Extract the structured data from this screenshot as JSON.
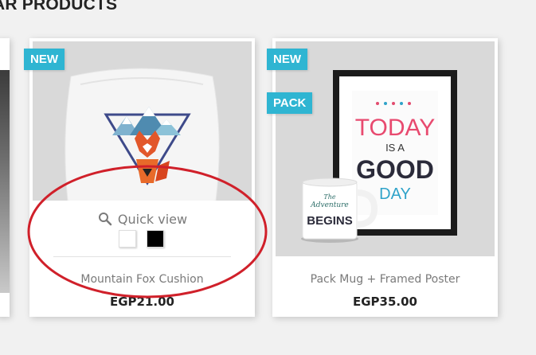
{
  "section": {
    "title": "AR PRODUCTS"
  },
  "products": [
    {
      "name": "Mountain Fox Cushion",
      "price": "EGP21.00",
      "badges": [
        "NEW"
      ],
      "quick_view": "Quick view",
      "colors": [
        {
          "name": "white",
          "hex": "#ffffff"
        },
        {
          "name": "black",
          "hex": "#000000"
        }
      ]
    },
    {
      "name": "Pack Mug + Framed Poster",
      "price": "EGP35.00",
      "badges": [
        "NEW",
        "PACK"
      ],
      "poster_text": [
        "TODAY",
        "IS A",
        "GOOD",
        "DAY"
      ],
      "mug_text": [
        "The",
        "Adventure",
        "BEGINS"
      ]
    }
  ],
  "colors": {
    "badge": "#2fb5d2",
    "annotation": "#d0202a"
  }
}
